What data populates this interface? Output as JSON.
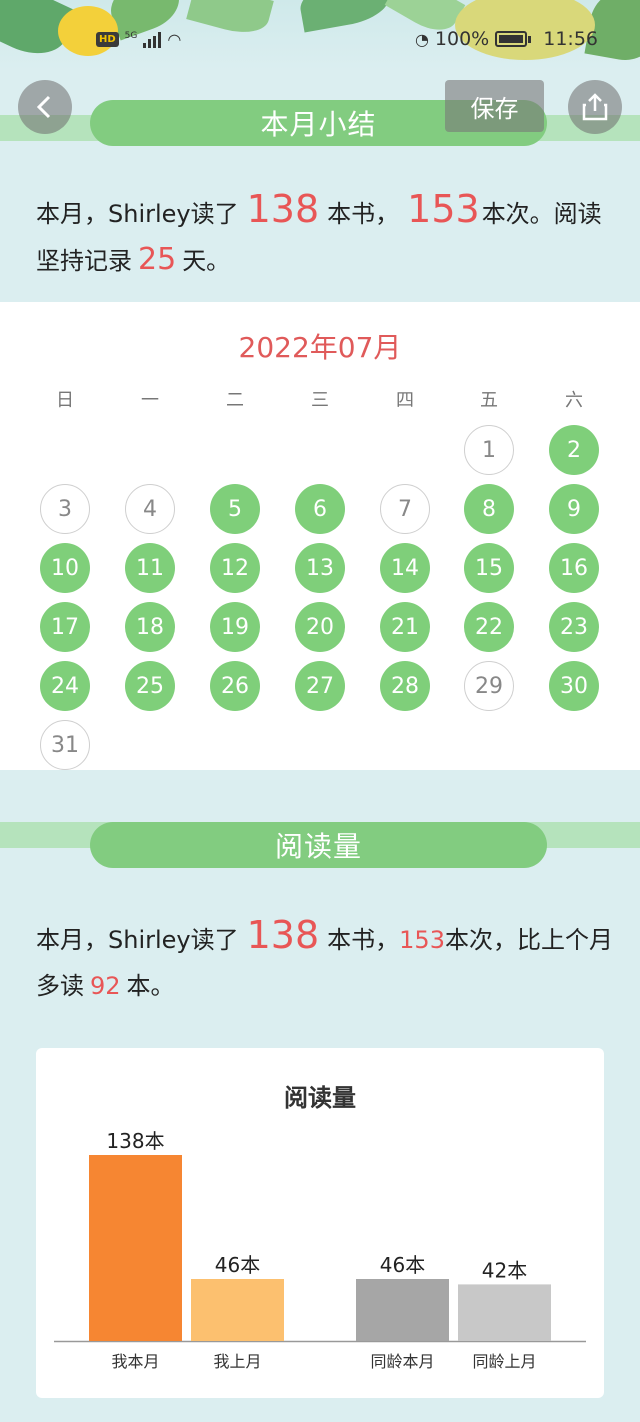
{
  "status_bar": {
    "hd": "HD",
    "network": "5G",
    "battery_text": "100%",
    "time": "11:56"
  },
  "header": {
    "back_icon": "chevron-left-icon",
    "save_label": "保存",
    "share_icon": "share-icon"
  },
  "summary": {
    "title": "本月小结",
    "t1": "本月，Shirley读了",
    "books": "138",
    "t2": "本书，",
    "times": "153",
    "t3": "本次。阅读坚持记录",
    "days": "25",
    "t4": "天。"
  },
  "calendar": {
    "month_label": "2022年07月",
    "weekdays": [
      "日",
      "一",
      "二",
      "三",
      "四",
      "五",
      "六"
    ],
    "first_weekday": 5,
    "days_in_month": 31,
    "read_days": [
      2,
      5,
      6,
      8,
      9,
      10,
      11,
      12,
      13,
      14,
      15,
      16,
      17,
      18,
      19,
      20,
      21,
      22,
      23,
      24,
      25,
      26,
      27,
      28,
      30
    ]
  },
  "reading": {
    "title": "阅读量",
    "t1": "本月，Shirley读了",
    "books": "138",
    "t2": "本书，",
    "times": "153",
    "t3": "本次，比上个月多读",
    "more": "92",
    "t4": "本。"
  },
  "colors": {
    "accent_green": "#82cc80",
    "highlight_red": "#e85656",
    "bar_me_month": "#f68632",
    "bar_me_last": "#fcc06f",
    "bar_peer_month": "#a6a6a6",
    "bar_peer_last": "#c8c8c8"
  },
  "chart_data": {
    "type": "bar",
    "title": "阅读量",
    "categories": [
      "我本月",
      "我上月",
      "同龄本月",
      "同龄上月"
    ],
    "values": [
      138,
      46,
      46,
      42
    ],
    "value_labels": [
      "138本",
      "46本",
      "46本",
      "42本"
    ],
    "xlabel": "",
    "ylabel": "",
    "grid": false,
    "legend": "none"
  }
}
